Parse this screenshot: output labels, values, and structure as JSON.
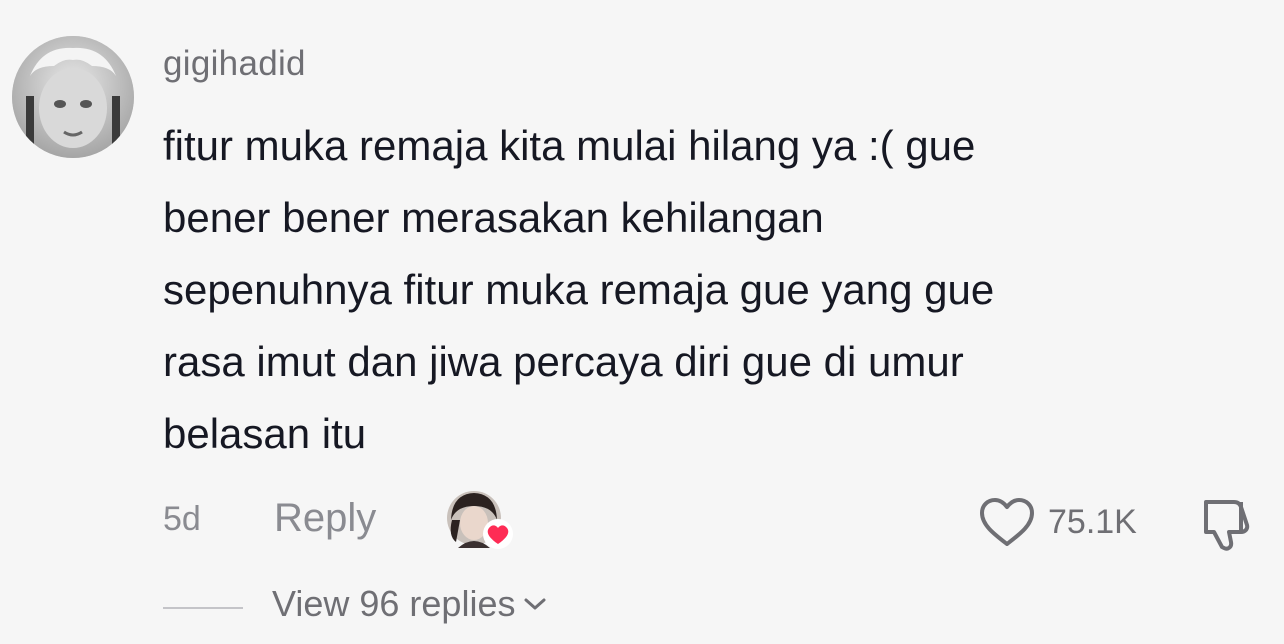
{
  "comment": {
    "username": "gigihadid",
    "text_lines": [
      "fitur muka remaja kita mulai hilang ya :( gue",
      "bener bener merasakan kehilangan",
      "sepenuhnya fitur muka remaja gue yang gue",
      "rasa imut dan jiwa percaya diri gue di umur",
      "belasan itu"
    ],
    "time": "5d",
    "reply_label": "Reply",
    "like_count": "75.1K",
    "liked_by_creator": true,
    "icons": {
      "like": "heart-outline-icon",
      "dislike": "thumbs-down-icon",
      "expand": "chevron-down-icon"
    },
    "colors": {
      "text": "#161823",
      "secondary": "#8a8b91",
      "creator_heart": "#fe2c55"
    }
  },
  "replies": {
    "label": "View 96 replies"
  }
}
